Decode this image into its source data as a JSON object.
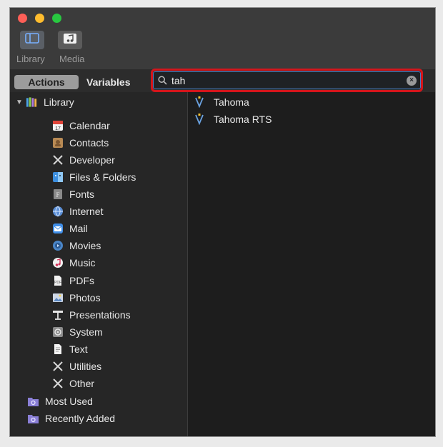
{
  "toolbar": {
    "library_label": "Library",
    "media_label": "Media"
  },
  "tabs": {
    "actions": "Actions",
    "variables": "Variables"
  },
  "search": {
    "value": "tah"
  },
  "sidebar": {
    "root": "Library",
    "items": [
      {
        "label": "Calendar",
        "icon": "calendar-icon"
      },
      {
        "label": "Contacts",
        "icon": "contacts-icon"
      },
      {
        "label": "Developer",
        "icon": "developer-icon"
      },
      {
        "label": "Files & Folders",
        "icon": "finder-icon"
      },
      {
        "label": "Fonts",
        "icon": "fonts-icon"
      },
      {
        "label": "Internet",
        "icon": "internet-icon"
      },
      {
        "label": "Mail",
        "icon": "mail-icon"
      },
      {
        "label": "Movies",
        "icon": "movies-icon"
      },
      {
        "label": "Music",
        "icon": "music-icon"
      },
      {
        "label": "PDFs",
        "icon": "pdf-icon"
      },
      {
        "label": "Photos",
        "icon": "photos-icon"
      },
      {
        "label": "Presentations",
        "icon": "presentations-icon"
      },
      {
        "label": "System",
        "icon": "system-icon"
      },
      {
        "label": "Text",
        "icon": "text-icon"
      },
      {
        "label": "Utilities",
        "icon": "utilities-icon"
      },
      {
        "label": "Other",
        "icon": "other-icon"
      }
    ],
    "folders": [
      {
        "label": "Most Used",
        "icon": "smart-folder-icon"
      },
      {
        "label": "Recently Added",
        "icon": "smart-folder-icon"
      }
    ]
  },
  "results": [
    {
      "label": "Tahoma",
      "icon": "font-action-icon"
    },
    {
      "label": "Tahoma RTS",
      "icon": "font-action-icon"
    }
  ],
  "colors": {
    "highlight": "#d4151b",
    "search_focus": "#4a7ec4"
  }
}
